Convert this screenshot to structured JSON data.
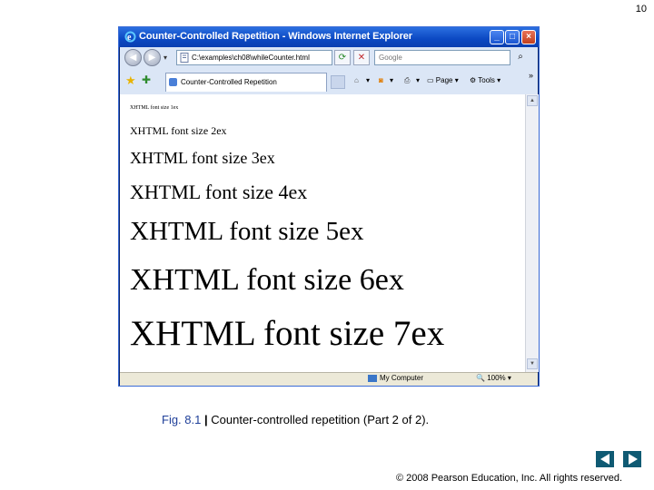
{
  "slide": {
    "number": "10"
  },
  "window": {
    "title": "Counter-Controlled Repetition - Windows Internet Explorer",
    "controls": {
      "minimize": "_",
      "maximize": "□",
      "close": "×"
    }
  },
  "toolbar": {
    "address": "C:\\examples\\ch08\\whileCounter.html",
    "search_placeholder": "Google",
    "tab_label": "Counter-Controlled Repetition",
    "commands": {
      "page": "Page",
      "tools": "Tools"
    }
  },
  "content": {
    "lines": [
      "XHTML font size 1ex",
      "XHTML font size 2ex",
      "XHTML font size 3ex",
      "XHTML font size 4ex",
      "XHTML font size 5ex",
      "XHTML font size 6ex",
      "XHTML font size 7ex"
    ]
  },
  "statusbar": {
    "zone": "My Computer",
    "zoom": "100%"
  },
  "caption": {
    "fig": "Fig. 8.1",
    "separator": "|",
    "text": "Counter-controlled repetition (Part 2 of 2)."
  },
  "footer": {
    "copyright": "© 2008 Pearson Education, Inc.  All rights reserved."
  },
  "colors": {
    "titlebar": "#0b48c2",
    "caption_fig": "#1f3f99",
    "nav_buttons": "#0f5a73"
  },
  "icons": [
    "ie-icon",
    "back-icon",
    "forward-icon",
    "refresh-icon",
    "stop-icon",
    "search-icon",
    "favorites-star-icon",
    "add-favorites-icon",
    "home-icon",
    "feeds-icon",
    "print-icon",
    "page-icon",
    "tools-gear-icon",
    "computer-icon",
    "zoom-icon",
    "previous-arrow-icon",
    "next-arrow-icon"
  ]
}
